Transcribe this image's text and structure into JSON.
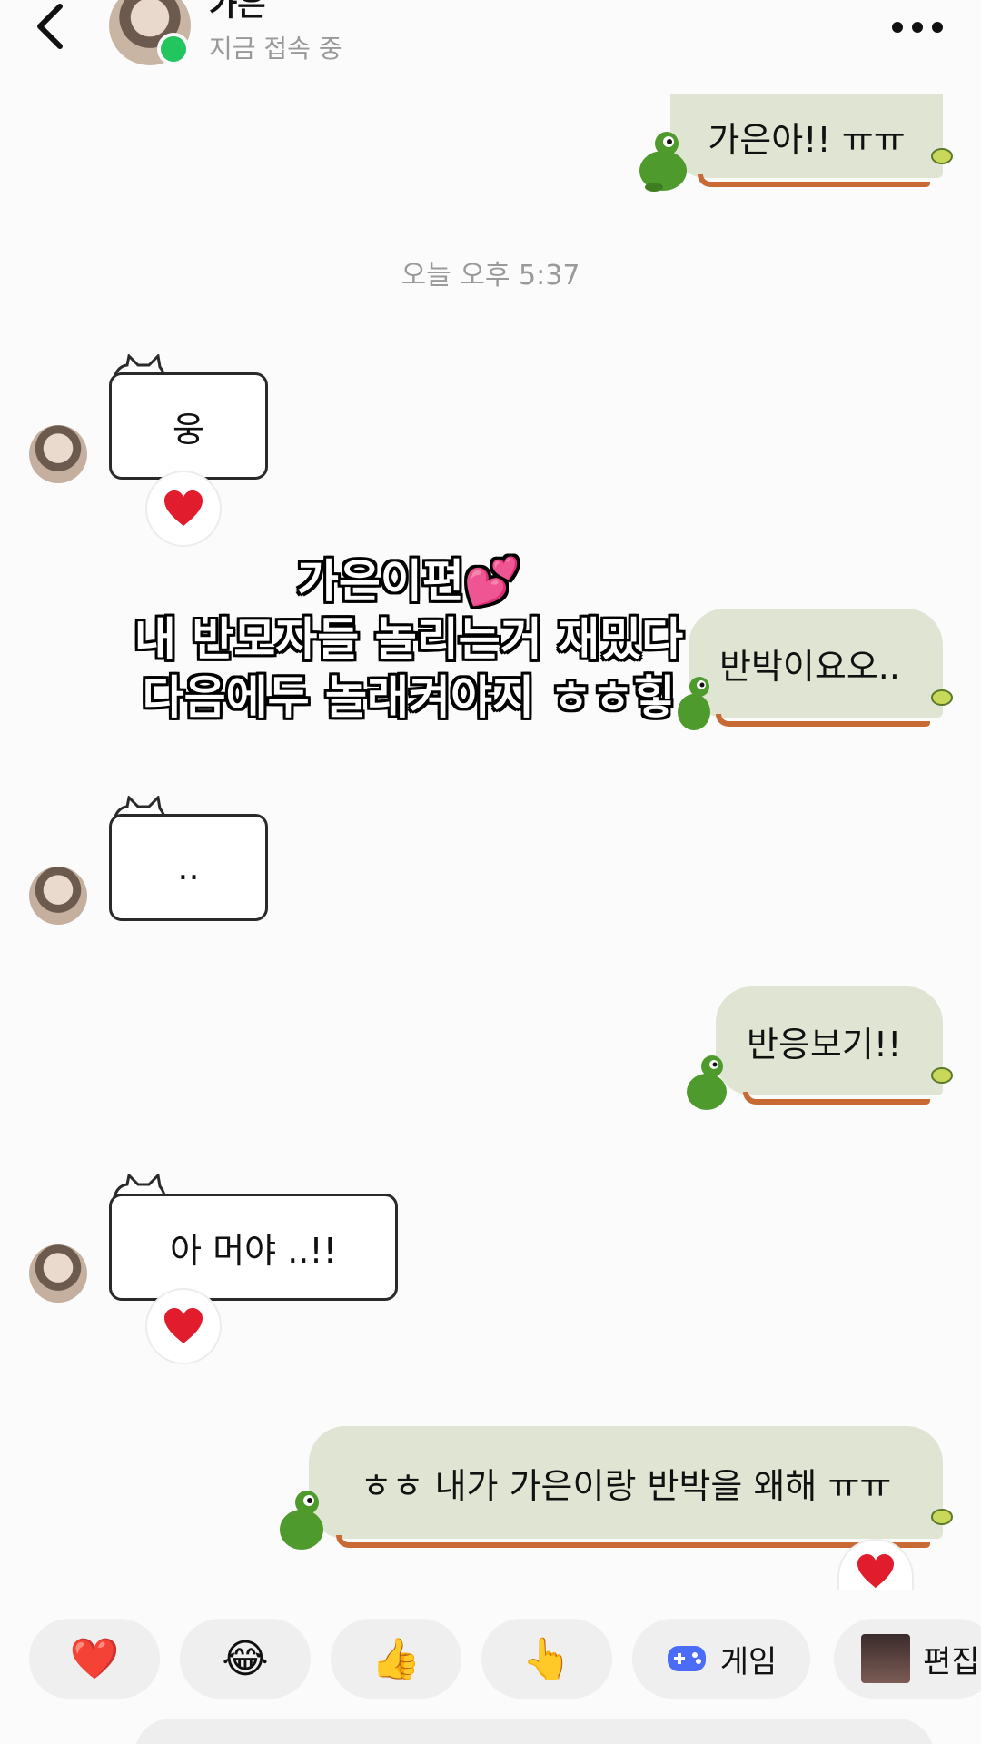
{
  "header": {
    "contact_name": "가은",
    "status": "지금 접속 중"
  },
  "timestamp": "오늘 오후 5:37",
  "messages": {
    "sent_1": "가은아!! ㅠㅠ",
    "friend_1": "웅",
    "sent_2": "반박이요오..",
    "friend_2": "..",
    "sent_3": "반응보기!!",
    "friend_3": "아 머야 ..!!",
    "sent_4": "ㅎㅎ 내가 가은이랑 반박을 왜해 ㅠㅠ"
  },
  "caption": {
    "line1": "가은이편💕",
    "line2": "내 반모자들 놀리는거 재밌다",
    "line3": "다음에두 놀래켜야지 ㅎㅎ힣"
  },
  "quick_bar": {
    "heart": "❤️",
    "laugh": "😂",
    "thumbs": "👍",
    "point": "👆",
    "game_label": "게임",
    "edit_label": "편집"
  },
  "icons": [
    "back-arrow-icon",
    "more-icon",
    "heart-icon",
    "frog-icon",
    "cat-icon",
    "gamepad-icon"
  ],
  "colors": {
    "sent_bubble": "#dfe5d2",
    "vine": "#c86a34",
    "online": "#22c55e",
    "frog": "#4f9a2c"
  }
}
